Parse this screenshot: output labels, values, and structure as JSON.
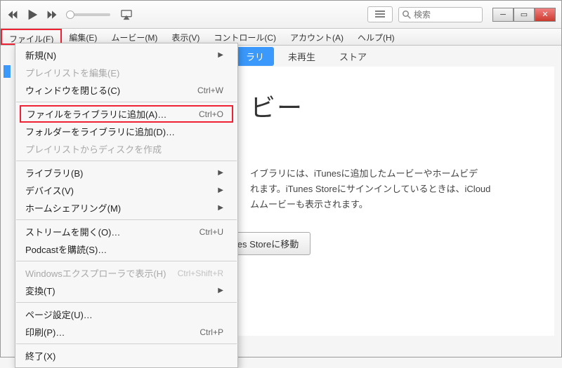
{
  "toolbar": {
    "search_placeholder": "検索"
  },
  "menubar": {
    "file": "ファイル(F)",
    "edit": "編集(E)",
    "movies": "ムービー(M)",
    "view": "表示(V)",
    "controls": "コントロール(C)",
    "account": "アカウント(A)",
    "help": "ヘルプ(H)"
  },
  "tabs": {
    "library_suffix": "ラリ",
    "unplayed": "未再生",
    "store": "ストア"
  },
  "content": {
    "heading": "ビー",
    "line1": "イブラリには、iTunesに追加したムービーやホームビデ",
    "line2": "れます。iTunes Storeにサインインしているときは、iCloud",
    "line3": "ムムービーも表示されます。",
    "store_btn": "iTunes Storeに移動"
  },
  "menu": {
    "new": "新規(N)",
    "edit_playlist": "プレイリストを編集(E)",
    "close_window": "ウィンドウを閉じる(C)",
    "close_window_sc": "Ctrl+W",
    "add_file": "ファイルをライブラリに追加(A)…",
    "add_file_sc": "Ctrl+O",
    "add_folder": "フォルダーをライブラリに追加(D)…",
    "burn": "プレイリストからディスクを作成",
    "library": "ライブラリ(B)",
    "devices": "デバイス(V)",
    "home_sharing": "ホームシェアリング(M)",
    "open_stream": "ストリームを開く(O)…",
    "open_stream_sc": "Ctrl+U",
    "subscribe_podcast": "Podcastを購読(S)…",
    "show_in_explorer": "Windowsエクスプローラで表示(H)",
    "show_in_explorer_sc": "Ctrl+Shift+R",
    "convert": "変換(T)",
    "page_setup": "ページ設定(U)…",
    "print": "印刷(P)…",
    "print_sc": "Ctrl+P",
    "exit": "終了(X)"
  }
}
